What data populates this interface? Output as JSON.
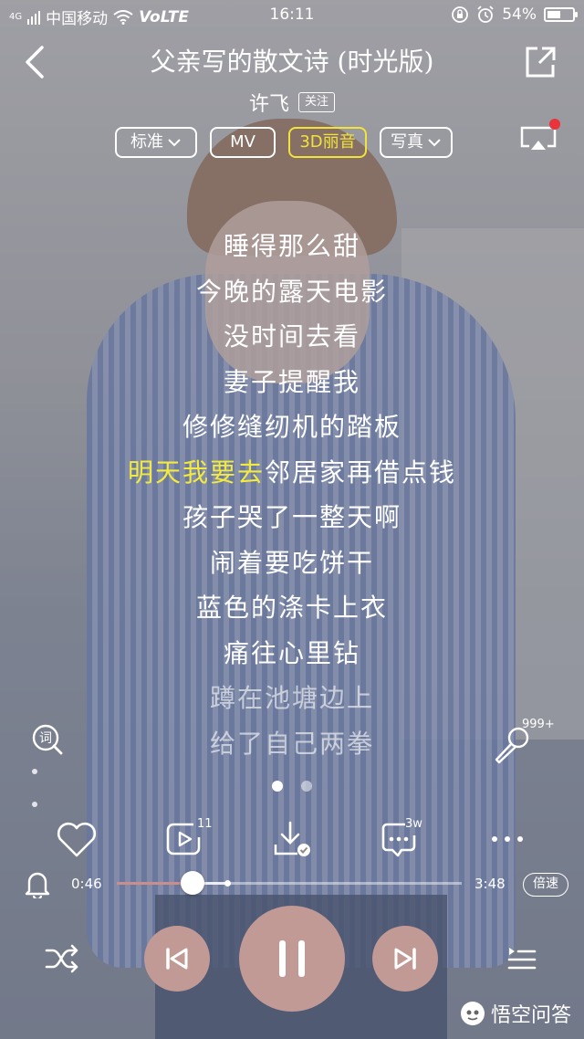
{
  "status_bar": {
    "signal_text": "4G",
    "carrier": "中国移动",
    "volte": "VoLTE",
    "time": "16:11",
    "battery_text": "54%",
    "battery_level": 0.54
  },
  "header": {
    "title": "父亲写的散文诗 (时光版)",
    "artist": "许飞",
    "follow_label": "关注"
  },
  "modes": [
    {
      "label": "标准",
      "has_dropdown": true,
      "active": false
    },
    {
      "label": "MV",
      "has_dropdown": false,
      "active": false
    },
    {
      "label": "3D丽音",
      "has_dropdown": false,
      "active": true
    },
    {
      "label": "写真",
      "has_dropdown": true,
      "active": false
    }
  ],
  "lyrics": {
    "lines": [
      "睡得那么甜",
      "今晚的露天电影",
      "没时间去看",
      "妻子提醒我",
      "修修缝纫机的踏板",
      "明天我要去邻居家再借点钱",
      "孩子哭了一整天啊",
      "闹着要吃饼干",
      "蓝色的涤卡上衣",
      "痛往心里钻",
      "蹲在池塘边上",
      "给了自己两拳"
    ],
    "current_sung": "明天我要去",
    "current_rest": "邻居家再借点钱"
  },
  "lyric_icon": "ci-text-icon",
  "karaoke": {
    "count": "999+"
  },
  "actions": {
    "video_count": "11",
    "comment_count": "3w"
  },
  "progress": {
    "current": "0:46",
    "total": "3:48",
    "played_fraction": 0.22,
    "buffered_fraction": 0.32,
    "speed_label": "倍速"
  },
  "watermark": {
    "text": "悟空问答"
  },
  "colors": {
    "accent_yellow": "#f3ea3e",
    "control_pink": "#c19995",
    "progress_played": "#c98f8f",
    "cast_dot": "#e8343a"
  }
}
